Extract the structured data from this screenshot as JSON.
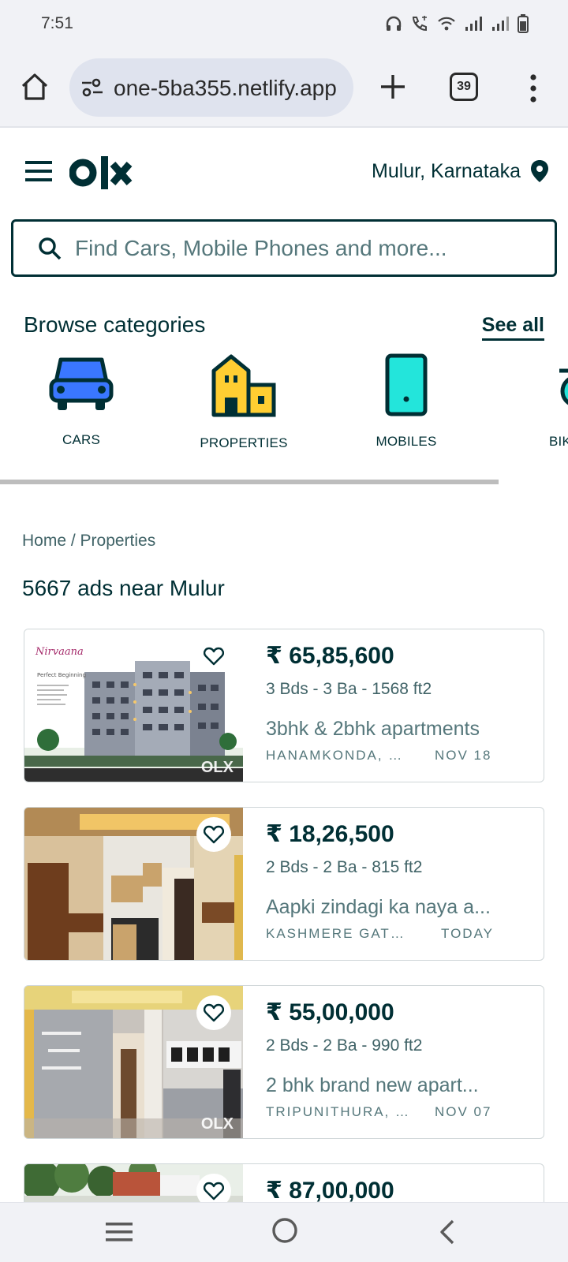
{
  "status_bar": {
    "time": "7:51"
  },
  "browser": {
    "url": "one-5ba355.netlify.app",
    "tab_count": "39"
  },
  "header": {
    "location": "Mulur, Karnataka"
  },
  "search": {
    "placeholder": "Find Cars, Mobile Phones and more..."
  },
  "categories": {
    "title": "Browse categories",
    "see_all": "See all",
    "items": [
      {
        "label": "CARS",
        "icon": "car-icon",
        "color": "#3a77ff"
      },
      {
        "label": "PROPERTIES",
        "icon": "building-icon",
        "color": "#ffce32"
      },
      {
        "label": "MOBILES",
        "icon": "mobile-icon",
        "color": "#23e5db"
      },
      {
        "label": "BIK",
        "icon": "bike-icon",
        "color": "#23e5db"
      }
    ]
  },
  "breadcrumb": "Home / Properties",
  "ads_count": "5667 ads near Mulur",
  "listings": [
    {
      "price": "₹ 65,85,600",
      "specs": "3 Bds - 3 Ba - 1568 ft2",
      "title": "3bhk & 2bhk apartments",
      "location": "HANAMKONDA, W...",
      "date": "NOV 18",
      "image_logo": "Nirvaana"
    },
    {
      "price": "₹ 18,26,500",
      "specs": "2 Bds - 2 Ba - 815 ft2",
      "title": "Aapki zindagi ka naya a...",
      "location": "KASHMERE GATE, ...",
      "date": "TODAY"
    },
    {
      "price": "₹ 55,00,000",
      "specs": "2 Bds - 2 Ba - 990 ft2",
      "title": "2 bhk brand new apart...",
      "location": "TRIPUNITHURA, K...",
      "date": "NOV 07"
    },
    {
      "price": "₹ 87,00,000"
    }
  ],
  "colors": {
    "brand": "#002f34",
    "muted": "#55777b",
    "nav_bg": "#f1f2f6"
  }
}
